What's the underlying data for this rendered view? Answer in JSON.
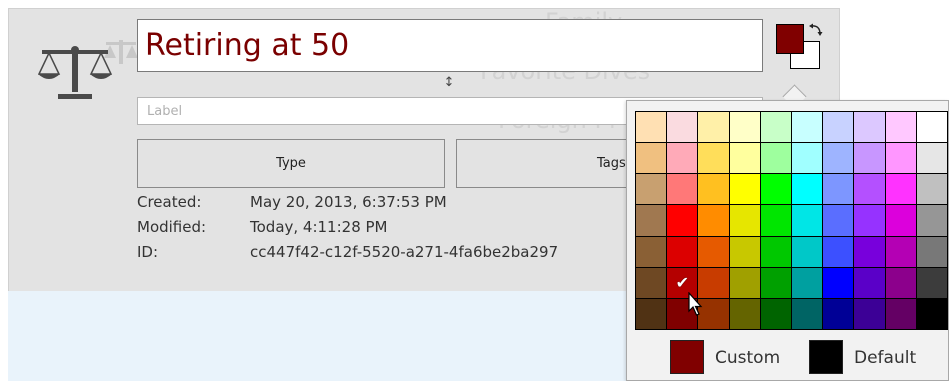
{
  "background_text": [
    "Family",
    "Favorite Dives",
    "Foreign Pl"
  ],
  "topic": {
    "title": "Retiring at 50",
    "label_placeholder": "Label",
    "label_value": "",
    "type_button": "Type",
    "tags_button": "Tags"
  },
  "metadata": [
    {
      "label": "Created:",
      "value": "May 20, 2013, 6:37:53 PM"
    },
    {
      "label": "Modified:",
      "value": "Today, 4:11:28 PM"
    },
    {
      "label": "ID:",
      "value": "cc447f42-c12f-5520-a271-4fa6be2ba297"
    }
  ],
  "colors": {
    "foreground": "#800000",
    "background": "#ffffff",
    "title_text": "#7a0000"
  },
  "icons": {
    "topic_icon": "scale-icon",
    "swap": "swap-colors-icon",
    "resize": "resize-vertical-icon",
    "selected": "checkmark-icon",
    "pointer": "mouse-cursor-icon"
  },
  "palette": {
    "selected_row": 5,
    "selected_col": 1,
    "rows": [
      [
        "#ffe0b3",
        "#fadbe0",
        "#fff0a8",
        "#ffffc8",
        "#c8ffc8",
        "#c8ffff",
        "#c8d2ff",
        "#dcc8ff",
        "#ffc8ff",
        "#ffffff"
      ],
      [
        "#f0c080",
        "#ffaab8",
        "#ffde5a",
        "#ffff9e",
        "#9eff9e",
        "#a0ffff",
        "#9eb4ff",
        "#c896ff",
        "#ff96ff",
        "#e6e6e6"
      ],
      [
        "#c8a070",
        "#ff7878",
        "#ffc020",
        "#ffff00",
        "#00ff00",
        "#00ffff",
        "#7d96ff",
        "#b450ff",
        "#ff32ff",
        "#c0c0c0"
      ],
      [
        "#a07850",
        "#ff0000",
        "#ff8c00",
        "#e6e600",
        "#00e600",
        "#00e6e6",
        "#5a6eff",
        "#9632ff",
        "#dc00dc",
        "#969696"
      ],
      [
        "#8a6035",
        "#dc0000",
        "#e65a00",
        "#c8c800",
        "#00c800",
        "#00c8c8",
        "#3c50ff",
        "#7800dc",
        "#b400b4",
        "#787878"
      ],
      [
        "#6e4823",
        "#b40000",
        "#c83c00",
        "#a0a000",
        "#00a000",
        "#00a0a0",
        "#0000ff",
        "#5a00c8",
        "#8c008c",
        "#3c3c3c"
      ],
      [
        "#503214",
        "#800000",
        "#963200",
        "#646400",
        "#006400",
        "#006464",
        "#000096",
        "#3c0096",
        "#640064",
        "#000000"
      ]
    ],
    "custom_label": "Custom",
    "custom_color": "#800000",
    "default_label": "Default",
    "default_color": "#000000"
  }
}
